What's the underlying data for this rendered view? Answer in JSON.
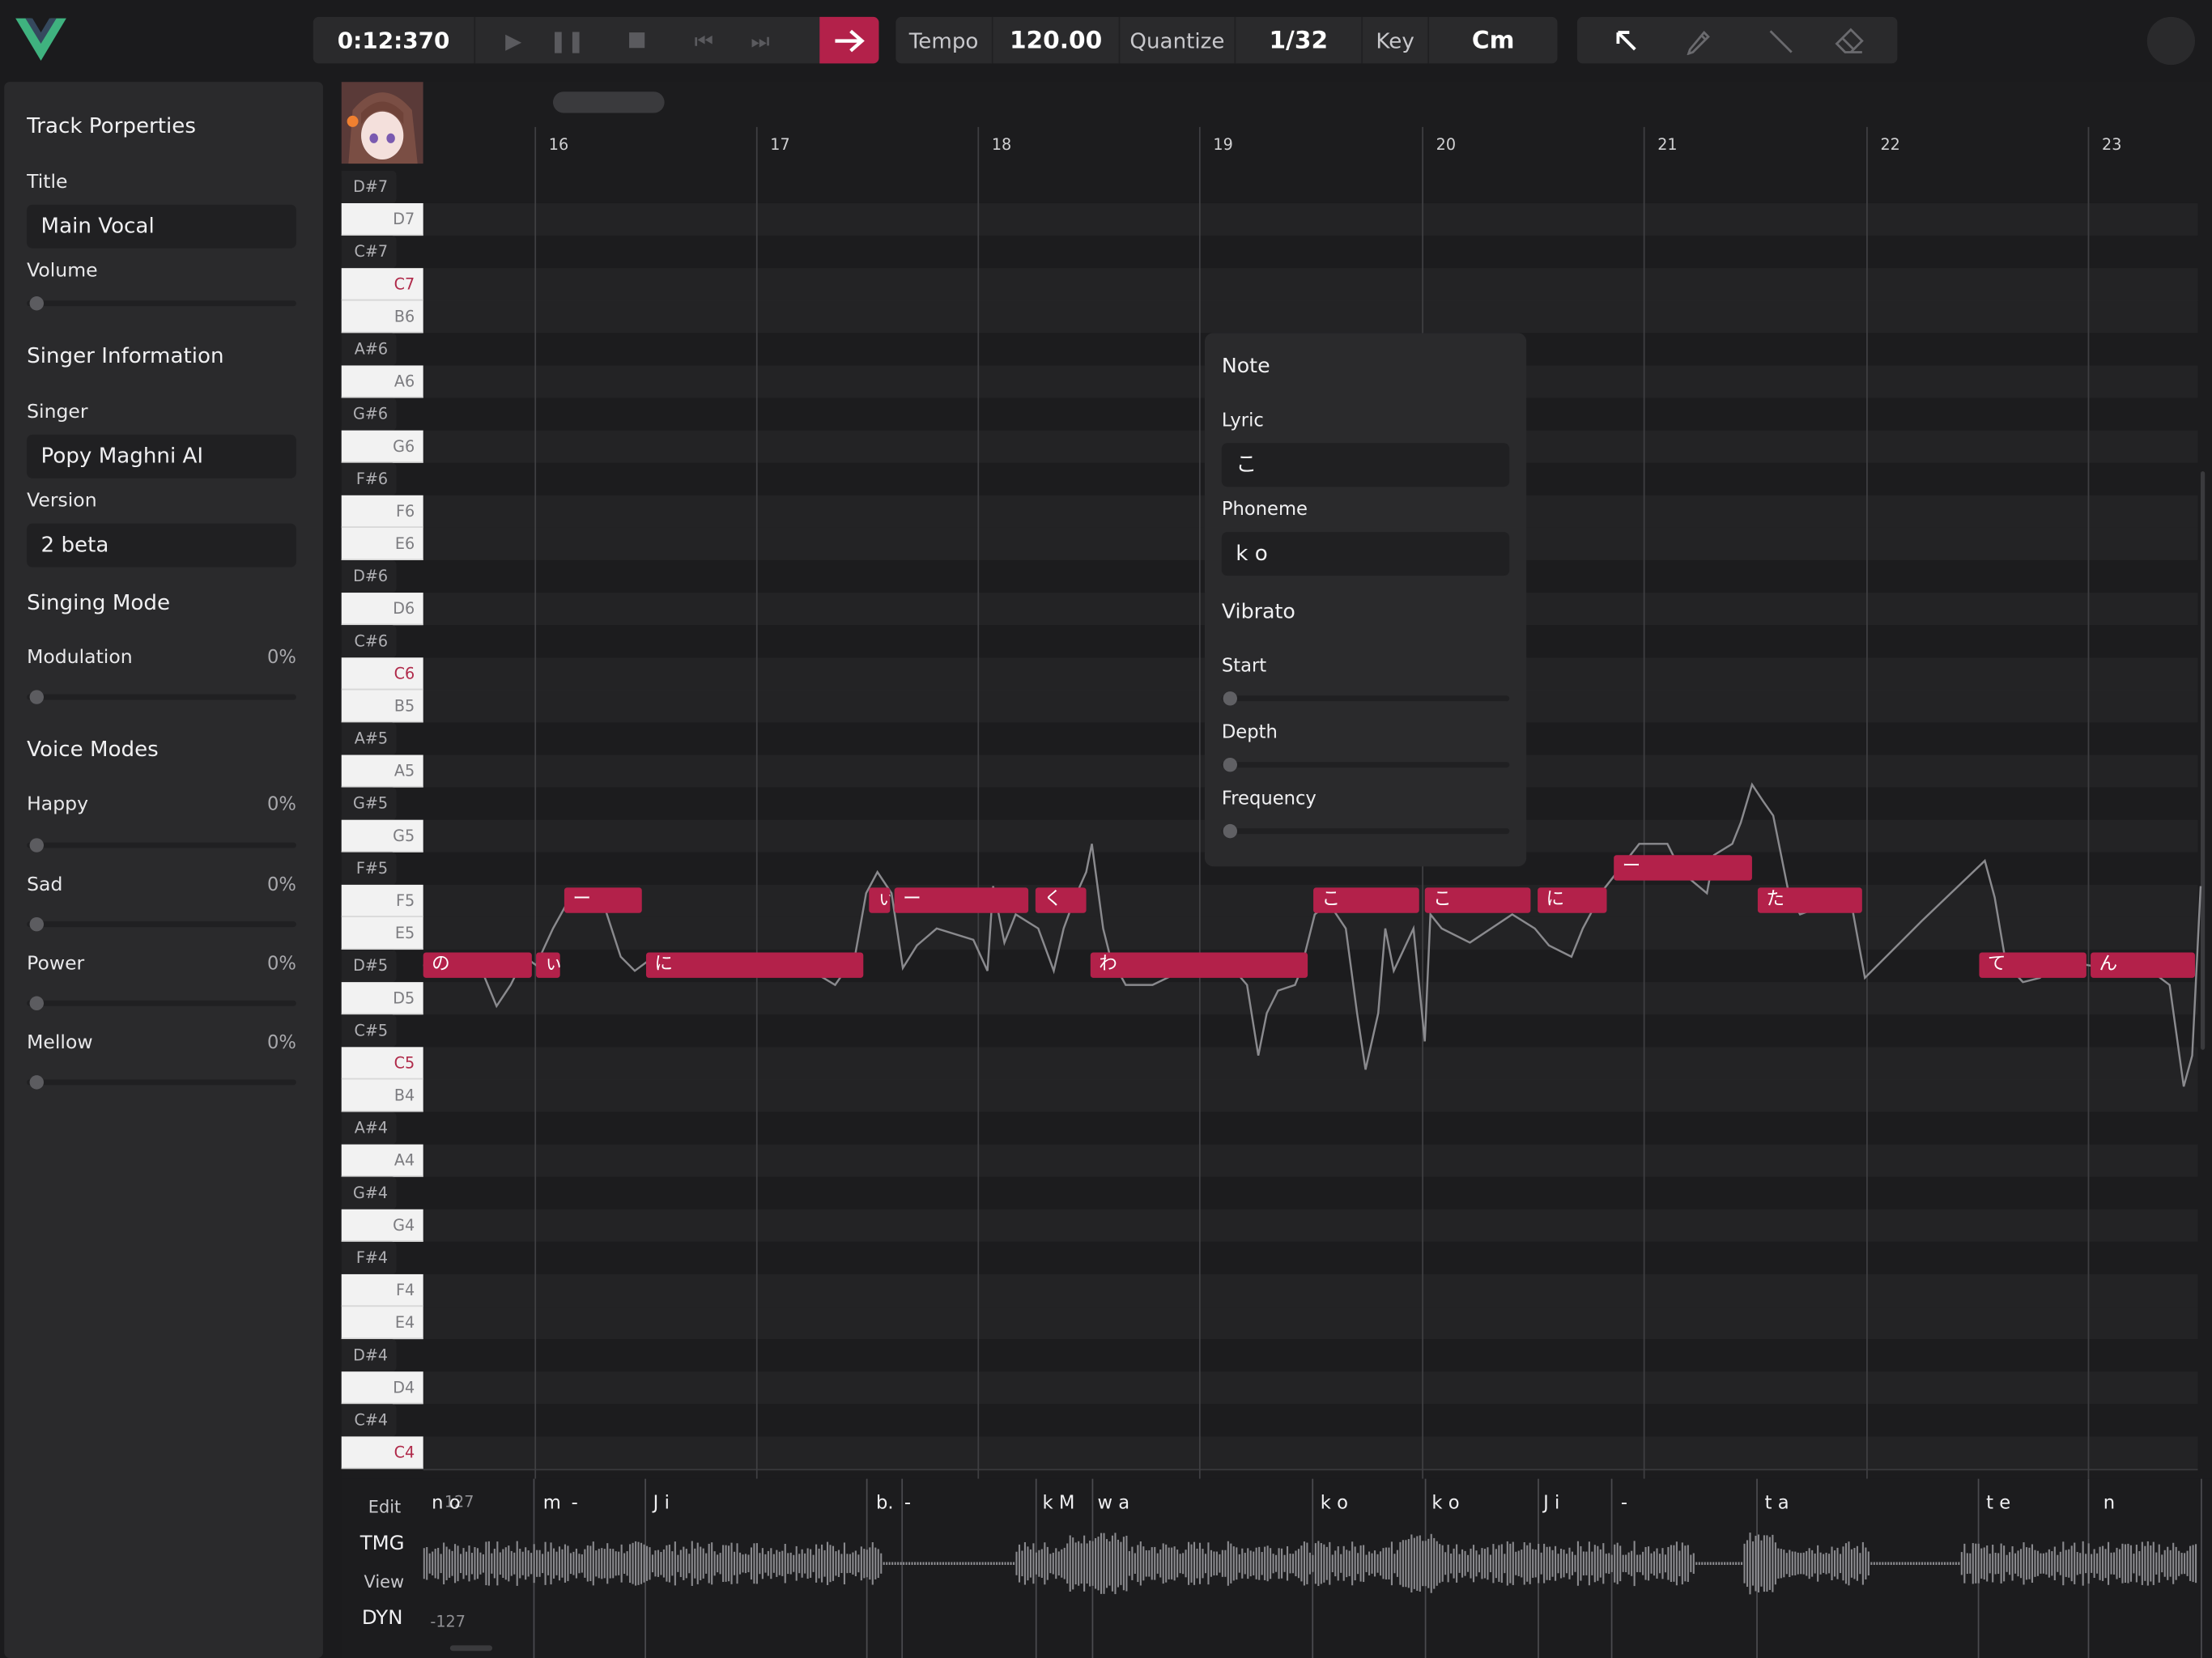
{
  "toolbar": {
    "time": "0:12:370",
    "tempo_label": "Tempo",
    "tempo_value": "120.00",
    "quantize_label": "Quantize",
    "quantize_value": "1/32",
    "key_label": "Key",
    "key_value": "Cm",
    "accent": "#b3214a"
  },
  "panel": {
    "track_heading": "Track Porperties",
    "title_label": "Title",
    "title_value": "Main Vocal",
    "volume_label": "Volume",
    "singer_heading": "Singer Information",
    "singer_label": "Singer",
    "singer_value": "Popy Maghni AI",
    "version_label": "Version",
    "version_value": "2 beta",
    "singing_mode_heading": "Singing Mode",
    "modulation_label": "Modulation",
    "modulation_value": "0%",
    "voice_modes_heading": "Voice Modes",
    "modes": [
      {
        "label": "Happy",
        "value": "0%"
      },
      {
        "label": "Sad",
        "value": "0%"
      },
      {
        "label": "Power",
        "value": "0%"
      },
      {
        "label": "Mellow",
        "value": "0%"
      }
    ]
  },
  "roll": {
    "bars": [
      "16",
      "17",
      "18",
      "19",
      "20",
      "21",
      "22",
      "23"
    ],
    "keys": [
      "D#7",
      "D7",
      "C#7",
      "C7",
      "B6",
      "A#6",
      "A6",
      "G#6",
      "G6",
      "F#6",
      "F6",
      "E6",
      "D#6",
      "D6",
      "C#6",
      "C6",
      "B5",
      "A#5",
      "A5",
      "G#5",
      "G5",
      "F#5",
      "F5",
      "E5",
      "D#5",
      "D5",
      "C#5",
      "C5",
      "B4",
      "A#4",
      "A4",
      "G#4",
      "G4",
      "F#4",
      "F4",
      "E4",
      "D#4",
      "D4",
      "C#4",
      "C4"
    ],
    "notes": [
      {
        "lyric": "の",
        "pitch": "D#5"
      },
      {
        "lyric": "ぃ",
        "pitch": "D#5"
      },
      {
        "lyric": "ー",
        "pitch": "F5"
      },
      {
        "lyric": "に",
        "pitch": "D#5"
      },
      {
        "lyric": "ぃ",
        "pitch": "F5"
      },
      {
        "lyric": "ー",
        "pitch": "F5"
      },
      {
        "lyric": "く",
        "pitch": "F5"
      },
      {
        "lyric": "わ",
        "pitch": "D#5"
      },
      {
        "lyric": "こ",
        "pitch": "F5"
      },
      {
        "lyric": "こ",
        "pitch": "F5"
      },
      {
        "lyric": "に",
        "pitch": "F5"
      },
      {
        "lyric": "ー",
        "pitch": "F#5"
      },
      {
        "lyric": "た",
        "pitch": "F5"
      },
      {
        "lyric": "て",
        "pitch": "D#5"
      },
      {
        "lyric": "ん",
        "pitch": "D#5"
      }
    ]
  },
  "note_popup": {
    "title": "Note",
    "lyric_label": "Lyric",
    "lyric_value": "こ",
    "phoneme_label": "Phoneme",
    "phoneme_value": "k o",
    "vibrato_heading": "Vibrato",
    "start_label": "Start",
    "depth_label": "Depth",
    "frequency_label": "Frequency"
  },
  "bottom": {
    "edit_label": "Edit",
    "tmg_label": "TMG",
    "view_label": "View",
    "dyn_label": "DYN",
    "top_value": "127",
    "bottom_value": "-127",
    "phonemes": [
      "n o",
      "m",
      "-",
      "J i",
      "b.",
      "-",
      "k M",
      "w a",
      "k o",
      "k o",
      "J i",
      "-",
      "t a",
      "t e",
      "n"
    ]
  }
}
